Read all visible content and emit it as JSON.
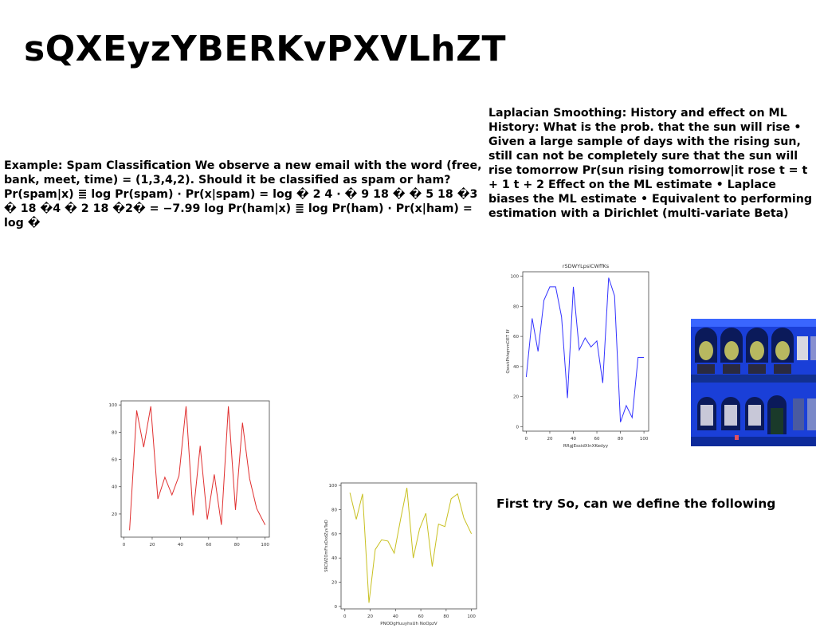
{
  "slide": {
    "title": "sQXEyzYBERKvPXVLhZT",
    "left_text": "Example: Spam Classification We observe a new email with the word (free, bank, meet, time) = (1,3,4,2). Should it be classified as spam or ham? Pr(spam|x) ≣ log Pr(spam) · Pr(x|spam) = log � 2 4 · � 9 18 � � 5 18 �3 � 18 �4 � 2 18 �2� = −7.99 log Pr(ham|x) ≣ log Pr(ham) · Pr(x|ham) = log �",
    "right_text": "Laplacian Smoothing: History and effect on ML History: What is the prob. that the sun will rise • Given a large sample of days with the rising sun, still can not be completely sure that the sun will rise tomorrow Pr(sun rising tomorrow|it rose t = t + 1 t + 2 Effect on the ML estimate • Laplace biases the ML estimate • Equivalent to performing estimation with a Dirichlet (multi-variate Beta)",
    "first_try": "First try So, can we define the following"
  },
  "chart_data": [
    {
      "id": "blue",
      "type": "line",
      "title": "rSDWYLpsiCWffKs",
      "xlabel": "RRgjEssidXlnXKedyy",
      "ylabel": "QssvkPhhqmmCIET Ef",
      "color": "#3333ff",
      "xlim": [
        -3,
        104
      ],
      "ylim": [
        -3,
        103
      ],
      "xticks": [
        0,
        20,
        40,
        60,
        80,
        100
      ],
      "yticks": [
        0,
        20,
        40,
        60,
        80,
        100
      ],
      "x": [
        0,
        5,
        10,
        15,
        20,
        25,
        30,
        35,
        40,
        45,
        50,
        55,
        60,
        65,
        70,
        75,
        80,
        85,
        90,
        95,
        100
      ],
      "y": [
        33,
        72,
        50,
        84,
        93,
        93,
        73,
        19,
        93,
        51,
        59,
        53,
        57,
        29,
        99,
        87,
        3,
        14,
        6,
        46,
        46
      ]
    },
    {
      "id": "red",
      "type": "line",
      "title": "",
      "xlabel": "",
      "ylabel": "",
      "color": "#e03030",
      "xlim": [
        -2,
        103
      ],
      "ylim": [
        3,
        103
      ],
      "xticks": [
        0,
        20,
        40,
        60,
        80,
        100
      ],
      "yticks": [
        20,
        40,
        60,
        80,
        100
      ],
      "x": [
        4,
        9,
        14,
        19,
        24,
        29,
        34,
        39,
        44,
        49,
        54,
        59,
        64,
        69,
        74,
        79,
        84,
        89,
        94,
        100
      ],
      "y": [
        8,
        96,
        69,
        99,
        31,
        47,
        34,
        48,
        99,
        19,
        70,
        16,
        49,
        12,
        99,
        23,
        87,
        46,
        24,
        12
      ]
    },
    {
      "id": "yellow",
      "type": "line",
      "title": "",
      "xlabel": "PNODgHuuyhsUh NoOpzV",
      "ylabel": "SRCWZOmFhxDxdZyvTwD",
      "color": "#c8c020",
      "xlim": [
        -3,
        104
      ],
      "ylim": [
        -2,
        102
      ],
      "xticks": [
        0,
        20,
        40,
        60,
        80,
        100
      ],
      "yticks": [
        0,
        20,
        40,
        60,
        80,
        100
      ],
      "x": [
        4,
        9,
        14,
        19,
        24,
        29,
        34,
        39,
        44,
        49,
        54,
        59,
        64,
        69,
        74,
        79,
        84,
        89,
        94,
        100
      ],
      "y": [
        94,
        72,
        93,
        3,
        47,
        55,
        54,
        44,
        72,
        98,
        40,
        64,
        77,
        33,
        68,
        66,
        89,
        93,
        73,
        60
      ]
    }
  ]
}
